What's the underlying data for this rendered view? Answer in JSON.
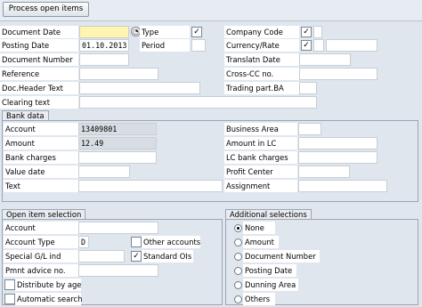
{
  "toolbar": {
    "process_label": "Process open items"
  },
  "header_fields": {
    "document_date": {
      "label": "Document Date",
      "value": ""
    },
    "type": {
      "label": "Type",
      "checked": true
    },
    "company_code": {
      "label": "Company Code",
      "checked": true
    },
    "posting_date": {
      "label": "Posting Date",
      "value": "01.10.2013"
    },
    "period": {
      "label": "Period",
      "value": ""
    },
    "currency_rate": {
      "label": "Currency/Rate",
      "checked": true
    },
    "document_number": {
      "label": "Document Number",
      "value": ""
    },
    "translatn_date": {
      "label": "Translatn Date",
      "value": ""
    },
    "reference": {
      "label": "Reference",
      "value": ""
    },
    "cross_cc_no": {
      "label": "Cross-CC no.",
      "value": ""
    },
    "doc_header_text": {
      "label": "Doc.Header Text",
      "value": ""
    },
    "trading_part_ba": {
      "label": "Trading part.BA",
      "value": ""
    },
    "clearing_text": {
      "label": "Clearing text",
      "value": ""
    }
  },
  "bank_data": {
    "title": "Bank data",
    "account": {
      "label": "Account",
      "value": "13409801"
    },
    "amount": {
      "label": "Amount",
      "value": "12.49"
    },
    "bank_charges": {
      "label": "Bank charges",
      "value": ""
    },
    "value_date": {
      "label": "Value date",
      "value": ""
    },
    "text": {
      "label": "Text",
      "value": ""
    },
    "business_area": {
      "label": "Business Area",
      "value": ""
    },
    "amount_in_lc": {
      "label": "Amount in LC",
      "value": ""
    },
    "lc_bank_charges": {
      "label": "LC bank charges",
      "value": ""
    },
    "profit_center": {
      "label": "Profit Center",
      "value": ""
    },
    "assignment": {
      "label": "Assignment",
      "value": ""
    }
  },
  "open_item_selection": {
    "title": "Open item selection",
    "account": {
      "label": "Account",
      "value": ""
    },
    "account_type": {
      "label": "Account Type",
      "value": "D"
    },
    "other_accounts": {
      "label": "Other accounts",
      "checked": false
    },
    "special_gl_ind": {
      "label": "Special G/L ind",
      "value": ""
    },
    "standard_ois": {
      "label": "Standard OIs",
      "checked": true
    },
    "pmnt_advice_no": {
      "label": "Pmnt advice no.",
      "value": ""
    },
    "distribute_by_age": {
      "label": "Distribute by age",
      "checked": false
    },
    "automatic_search": {
      "label": "Automatic search",
      "checked": false
    }
  },
  "additional_selections": {
    "title": "Additional selections",
    "options": [
      {
        "label": "None",
        "selected": true
      },
      {
        "label": "Amount",
        "selected": false
      },
      {
        "label": "Document Number",
        "selected": false
      },
      {
        "label": "Posting Date",
        "selected": false
      },
      {
        "label": "Dunning Area",
        "selected": false
      },
      {
        "label": "Others",
        "selected": false
      }
    ]
  },
  "icons": {
    "checkmark": "✓",
    "picker": "search-help-icon"
  },
  "colors": {
    "required_field": "#fff4b0",
    "frame_bg": "#dfe6ee",
    "readonly_field": "#d8dde3"
  }
}
